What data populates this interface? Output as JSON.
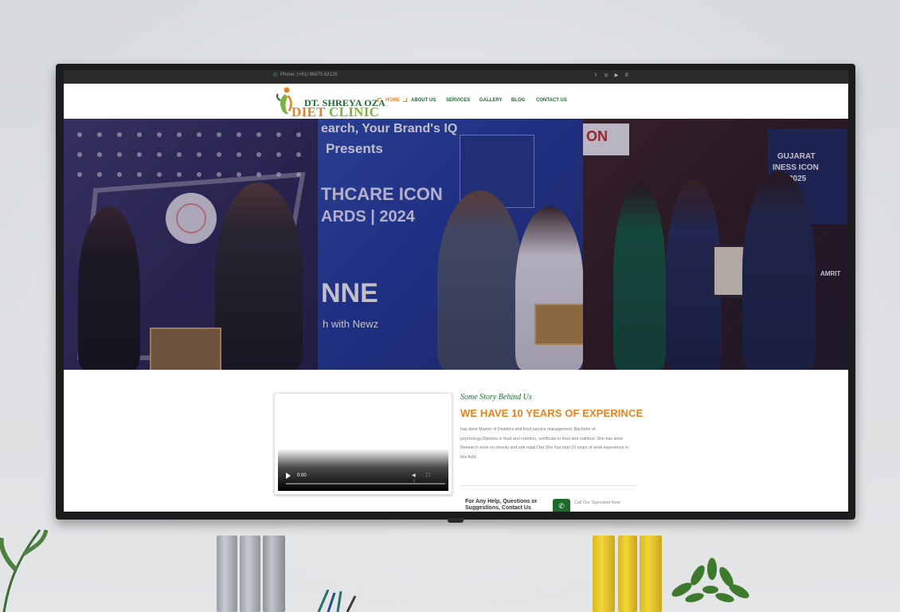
{
  "topbar": {
    "phone": "Phone: (+91) 96875 63126",
    "phone_icon": "phone-icon",
    "social_icons": [
      "facebook-icon",
      "instagram-icon",
      "youtube-icon",
      "whatsapp-icon"
    ],
    "social_glyphs": [
      "f",
      "◎",
      "▶",
      "✆"
    ]
  },
  "logo": {
    "line1": "DT. SHREYA OZA",
    "line2_a": "DIET",
    "line2_b": " CLINIC"
  },
  "nav": {
    "items": [
      {
        "label": "HOME",
        "active": true
      },
      {
        "label": "ABOUT US"
      },
      {
        "label": "SERVICES"
      },
      {
        "label": "GALLERY"
      },
      {
        "label": "BLOG"
      },
      {
        "label": "CONTACT US"
      }
    ]
  },
  "hero": {
    "panel2_text1": "earch, Your Brand's IQ",
    "panel2_text2": "Presents",
    "panel2_text3": "THCARE ICON",
    "panel2_text4": "ARDS | 2024",
    "panel2_text5": "NNE",
    "panel2_text6": "h with Newz",
    "panel3_text1": "ON",
    "panel3_text2": "GUJARAT",
    "panel3_text3": "INESS ICON",
    "panel3_text4": "D 2025",
    "panel3_text5": "AMRIT"
  },
  "video": {
    "time": "0:00"
  },
  "story": {
    "kicker": "Some Story Behind Us",
    "title": "WE HAVE 10 YEARS OF EXPERINCE",
    "body": "has done Master of Dietetics and food service management, Bachelor of psychology,Diploma in food and nutrition, certificate in food and nutrition. She has done Research work on obesity and anti-natal Diet.She has total 10 years of work experience in this field.",
    "help": "For Any Help, Questions or Suggestions, Contact Us",
    "call_label": "Call Our Specialist Now",
    "call_icon": "✆"
  },
  "colors": {
    "brand_green": "#1d6a2f",
    "brand_orange": "#e7821e",
    "topbar": "#2b2b2b"
  }
}
